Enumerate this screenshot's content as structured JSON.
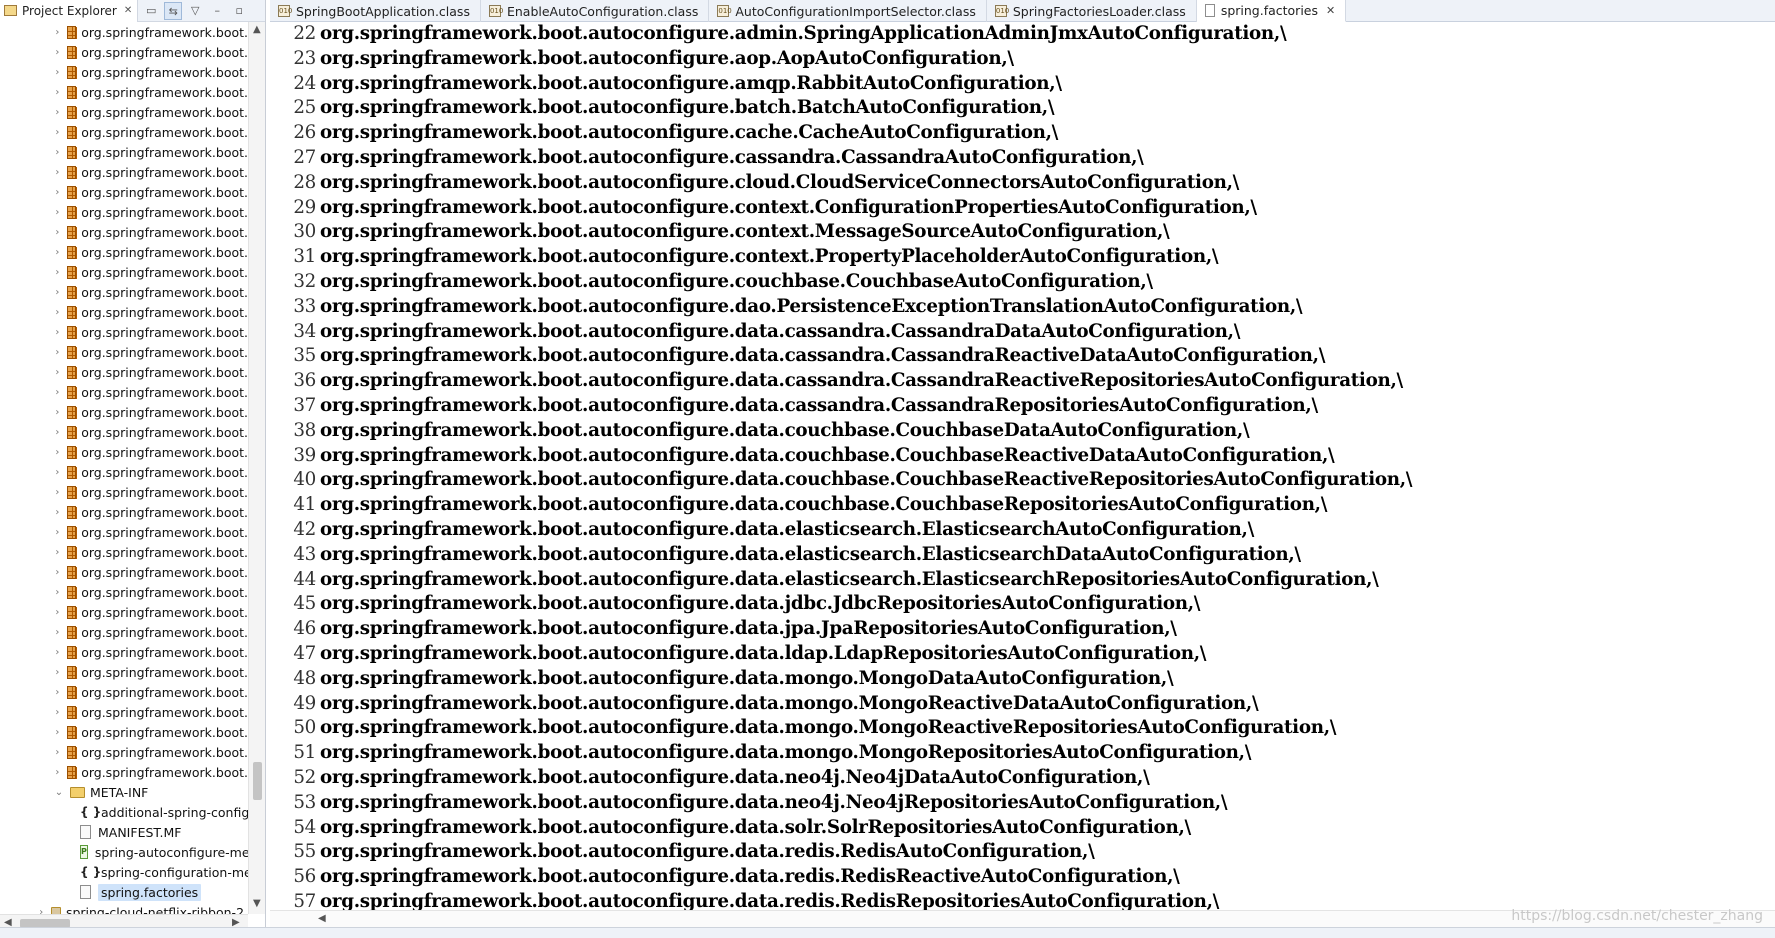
{
  "explorer": {
    "title": "Project Explorer",
    "close": "✕",
    "tree": [
      {
        "kind": "pkg",
        "label": "org.springframework.boot."
      },
      {
        "kind": "pkg",
        "label": "org.springframework.boot."
      },
      {
        "kind": "pkg",
        "label": "org.springframework.boot."
      },
      {
        "kind": "pkg",
        "label": "org.springframework.boot."
      },
      {
        "kind": "pkg",
        "label": "org.springframework.boot."
      },
      {
        "kind": "pkg",
        "label": "org.springframework.boot."
      },
      {
        "kind": "pkg",
        "label": "org.springframework.boot."
      },
      {
        "kind": "pkg",
        "label": "org.springframework.boot."
      },
      {
        "kind": "pkg",
        "label": "org.springframework.boot."
      },
      {
        "kind": "pkg",
        "label": "org.springframework.boot."
      },
      {
        "kind": "pkg",
        "label": "org.springframework.boot."
      },
      {
        "kind": "pkg",
        "label": "org.springframework.boot."
      },
      {
        "kind": "pkg",
        "label": "org.springframework.boot."
      },
      {
        "kind": "pkg",
        "label": "org.springframework.boot."
      },
      {
        "kind": "pkg",
        "label": "org.springframework.boot."
      },
      {
        "kind": "pkg",
        "label": "org.springframework.boot."
      },
      {
        "kind": "pkg",
        "label": "org.springframework.boot."
      },
      {
        "kind": "pkg",
        "label": "org.springframework.boot."
      },
      {
        "kind": "pkg",
        "label": "org.springframework.boot."
      },
      {
        "kind": "pkg",
        "label": "org.springframework.boot."
      },
      {
        "kind": "pkg",
        "label": "org.springframework.boot."
      },
      {
        "kind": "pkg",
        "label": "org.springframework.boot."
      },
      {
        "kind": "pkg",
        "label": "org.springframework.boot."
      },
      {
        "kind": "pkg",
        "label": "org.springframework.boot."
      },
      {
        "kind": "pkg",
        "label": "org.springframework.boot."
      },
      {
        "kind": "pkg",
        "label": "org.springframework.boot."
      },
      {
        "kind": "pkg",
        "label": "org.springframework.boot."
      },
      {
        "kind": "pkg",
        "label": "org.springframework.boot."
      },
      {
        "kind": "pkg",
        "label": "org.springframework.boot."
      },
      {
        "kind": "pkg",
        "label": "org.springframework.boot."
      },
      {
        "kind": "pkg",
        "label": "org.springframework.boot."
      },
      {
        "kind": "pkg",
        "label": "org.springframework.boot."
      },
      {
        "kind": "pkg",
        "label": "org.springframework.boot."
      },
      {
        "kind": "pkg",
        "label": "org.springframework.boot."
      },
      {
        "kind": "pkg",
        "label": "org.springframework.boot."
      },
      {
        "kind": "pkg",
        "label": "org.springframework.boot."
      },
      {
        "kind": "pkg",
        "label": "org.springframework.boot."
      },
      {
        "kind": "pkg",
        "label": "org.springframework.boot."
      },
      {
        "kind": "folder",
        "label": "META-INF"
      },
      {
        "kind": "json",
        "label": "additional-spring-config"
      },
      {
        "kind": "mf",
        "label": "MANIFEST.MF"
      },
      {
        "kind": "props",
        "label": "spring-autoconfigure-me"
      },
      {
        "kind": "json",
        "label": "spring-configuration-me"
      },
      {
        "kind": "sel",
        "label": "spring.factories"
      },
      {
        "kind": "jar",
        "label": "spring-cloud-netflix-ribbon-2."
      }
    ]
  },
  "tabs": [
    {
      "label": "SpringBootApplication.class",
      "icon": "class-file-icon"
    },
    {
      "label": "EnableAutoConfiguration.class",
      "icon": "class-file-icon"
    },
    {
      "label": "AutoConfigurationImportSelector.class",
      "icon": "class-file-icon"
    },
    {
      "label": "SpringFactoriesLoader.class",
      "icon": "class-file-icon"
    },
    {
      "label": "spring.factories",
      "icon": "text-file-icon",
      "active": true,
      "close": "✕"
    }
  ],
  "code": [
    {
      "n": "22",
      "t": "org.springframework.boot.autoconfigure.admin.SpringApplicationAdminJmxAutoConfiguration,\\"
    },
    {
      "n": "23",
      "t": "org.springframework.boot.autoconfigure.aop.AopAutoConfiguration,\\"
    },
    {
      "n": "24",
      "t": "org.springframework.boot.autoconfigure.amqp.RabbitAutoConfiguration,\\"
    },
    {
      "n": "25",
      "t": "org.springframework.boot.autoconfigure.batch.BatchAutoConfiguration,\\"
    },
    {
      "n": "26",
      "t": "org.springframework.boot.autoconfigure.cache.CacheAutoConfiguration,\\"
    },
    {
      "n": "27",
      "t": "org.springframework.boot.autoconfigure.cassandra.CassandraAutoConfiguration,\\"
    },
    {
      "n": "28",
      "t": "org.springframework.boot.autoconfigure.cloud.CloudServiceConnectorsAutoConfiguration,\\"
    },
    {
      "n": "29",
      "t": "org.springframework.boot.autoconfigure.context.ConfigurationPropertiesAutoConfiguration,\\"
    },
    {
      "n": "30",
      "t": "org.springframework.boot.autoconfigure.context.MessageSourceAutoConfiguration,\\"
    },
    {
      "n": "31",
      "t": "org.springframework.boot.autoconfigure.context.PropertyPlaceholderAutoConfiguration,\\"
    },
    {
      "n": "32",
      "t": "org.springframework.boot.autoconfigure.couchbase.CouchbaseAutoConfiguration,\\"
    },
    {
      "n": "33",
      "t": "org.springframework.boot.autoconfigure.dao.PersistenceExceptionTranslationAutoConfiguration,\\"
    },
    {
      "n": "34",
      "t": "org.springframework.boot.autoconfigure.data.cassandra.CassandraDataAutoConfiguration,\\"
    },
    {
      "n": "35",
      "t": "org.springframework.boot.autoconfigure.data.cassandra.CassandraReactiveDataAutoConfiguration,\\"
    },
    {
      "n": "36",
      "t": "org.springframework.boot.autoconfigure.data.cassandra.CassandraReactiveRepositoriesAutoConfiguration,\\"
    },
    {
      "n": "37",
      "t": "org.springframework.boot.autoconfigure.data.cassandra.CassandraRepositoriesAutoConfiguration,\\"
    },
    {
      "n": "38",
      "t": "org.springframework.boot.autoconfigure.data.couchbase.CouchbaseDataAutoConfiguration,\\"
    },
    {
      "n": "39",
      "t": "org.springframework.boot.autoconfigure.data.couchbase.CouchbaseReactiveDataAutoConfiguration,\\"
    },
    {
      "n": "40",
      "t": "org.springframework.boot.autoconfigure.data.couchbase.CouchbaseReactiveRepositoriesAutoConfiguration,\\"
    },
    {
      "n": "41",
      "t": "org.springframework.boot.autoconfigure.data.couchbase.CouchbaseRepositoriesAutoConfiguration,\\"
    },
    {
      "n": "42",
      "t": "org.springframework.boot.autoconfigure.data.elasticsearch.ElasticsearchAutoConfiguration,\\"
    },
    {
      "n": "43",
      "t": "org.springframework.boot.autoconfigure.data.elasticsearch.ElasticsearchDataAutoConfiguration,\\"
    },
    {
      "n": "44",
      "t": "org.springframework.boot.autoconfigure.data.elasticsearch.ElasticsearchRepositoriesAutoConfiguration,\\"
    },
    {
      "n": "45",
      "t": "org.springframework.boot.autoconfigure.data.jdbc.JdbcRepositoriesAutoConfiguration,\\"
    },
    {
      "n": "46",
      "t": "org.springframework.boot.autoconfigure.data.jpa.JpaRepositoriesAutoConfiguration,\\"
    },
    {
      "n": "47",
      "t": "org.springframework.boot.autoconfigure.data.ldap.LdapRepositoriesAutoConfiguration,\\"
    },
    {
      "n": "48",
      "t": "org.springframework.boot.autoconfigure.data.mongo.MongoDataAutoConfiguration,\\"
    },
    {
      "n": "49",
      "t": "org.springframework.boot.autoconfigure.data.mongo.MongoReactiveDataAutoConfiguration,\\"
    },
    {
      "n": "50",
      "t": "org.springframework.boot.autoconfigure.data.mongo.MongoReactiveRepositoriesAutoConfiguration,\\"
    },
    {
      "n": "51",
      "t": "org.springframework.boot.autoconfigure.data.mongo.MongoRepositoriesAutoConfiguration,\\"
    },
    {
      "n": "52",
      "t": "org.springframework.boot.autoconfigure.data.neo4j.Neo4jDataAutoConfiguration,\\"
    },
    {
      "n": "53",
      "t": "org.springframework.boot.autoconfigure.data.neo4j.Neo4jRepositoriesAutoConfiguration,\\"
    },
    {
      "n": "54",
      "t": "org.springframework.boot.autoconfigure.data.solr.SolrRepositoriesAutoConfiguration,\\"
    },
    {
      "n": "55",
      "t": "org.springframework.boot.autoconfigure.data.redis.RedisAutoConfiguration,\\"
    },
    {
      "n": "56",
      "t": "org.springframework.boot.autoconfigure.data.redis.RedisReactiveAutoConfiguration,\\"
    },
    {
      "n": "57",
      "t": "org.springframework.boot.autoconfigure.data.redis.RedisRepositoriesAutoConfiguration,\\"
    }
  ],
  "watermark": "https://blog.csdn.net/chester_zhang",
  "colors": {
    "selection": "#cfe3fa",
    "package_icon": "#e6a24a",
    "tabbar": "#eef2f8"
  }
}
